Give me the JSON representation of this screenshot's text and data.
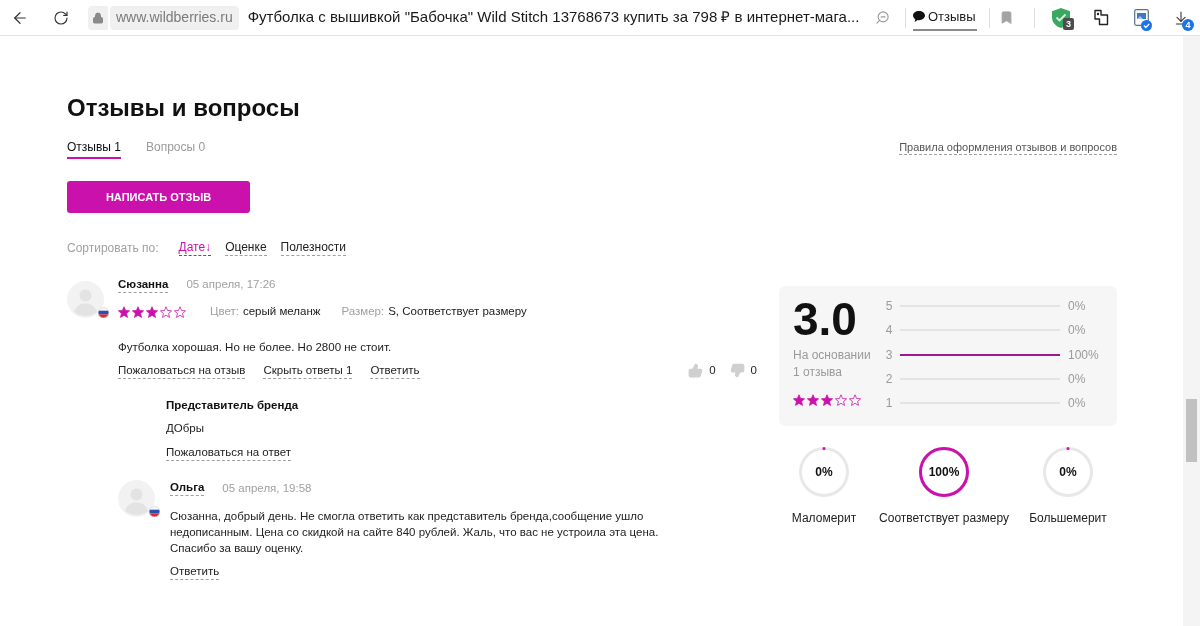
{
  "toolbar": {
    "url": "www.wildberries.ru",
    "title": "Футболка с вышивкой \"Бабочка\" Wild Stitch 13768673 купить за 798 ₽ в интернет-мага...",
    "reviews_label": "Отзывы",
    "extension_badge": "3",
    "downloads_badge": "4"
  },
  "heading": "Отзывы и вопросы",
  "tabs": [
    {
      "label": "Отзывы 1",
      "selected": true
    },
    {
      "label": "Вопросы 0",
      "selected": false
    }
  ],
  "rules_link": "Правила оформления отзывов и вопросов",
  "write_button": "НАПИСАТЬ ОТЗЫВ",
  "sort": {
    "label": "Сортировать по:",
    "options": [
      {
        "label": "Дате↓",
        "selected": true
      },
      {
        "label": "Оценке",
        "selected": false
      },
      {
        "label": "Полезности",
        "selected": false
      }
    ]
  },
  "review": {
    "author": "Сюзанна",
    "date": "05 апреля, 17:26",
    "stars": 3,
    "color_label": "Цвет:",
    "color_value": "серый меланж",
    "size_label": "Размер:",
    "size_value": "S, Соответствует размеру",
    "text": "Футболка хорошая. Но не более. Но 2800 не стоит.",
    "actions": [
      "Пожаловаться на отзыв",
      "Скрыть ответы 1",
      "Ответить"
    ],
    "likes": "0",
    "dislikes": "0",
    "replies": [
      {
        "kind": "brand",
        "author": "Представитель бренда",
        "text": "ДОбры",
        "actions": [
          "Пожаловаться на ответ"
        ]
      },
      {
        "kind": "user",
        "author": "Ольга",
        "date": "05 апреля, 19:58",
        "text": "Сюзанна, добрый день. Не смогла ответить как представитель бренда,сообщение ушло недописанным. Цена со скидкой на сайте 840 рублей. Жаль, что вас не устроила эта цена. Спасибо за вашу оценку.",
        "actions": [
          "Ответить"
        ]
      }
    ]
  },
  "summary": {
    "rating": "3.0",
    "caption_lines": [
      "На основании",
      "1 отзыва"
    ],
    "stars": 3,
    "distribution": [
      {
        "label": "5",
        "level": 0,
        "reading": "0%"
      },
      {
        "label": "4",
        "level": 0,
        "reading": "0%"
      },
      {
        "label": "3",
        "level": 1,
        "reading": "100%"
      },
      {
        "label": "2",
        "level": 0,
        "reading": "0%"
      },
      {
        "label": "1",
        "level": 0,
        "reading": "0%"
      }
    ]
  },
  "size_fit": [
    {
      "label": "Маломерит",
      "level": 0,
      "reading": "0%"
    },
    {
      "label": "Соответствует размеру",
      "level": 1,
      "reading": "100%"
    },
    {
      "label": "Большемерит",
      "level": 0,
      "reading": "0%"
    }
  ]
}
